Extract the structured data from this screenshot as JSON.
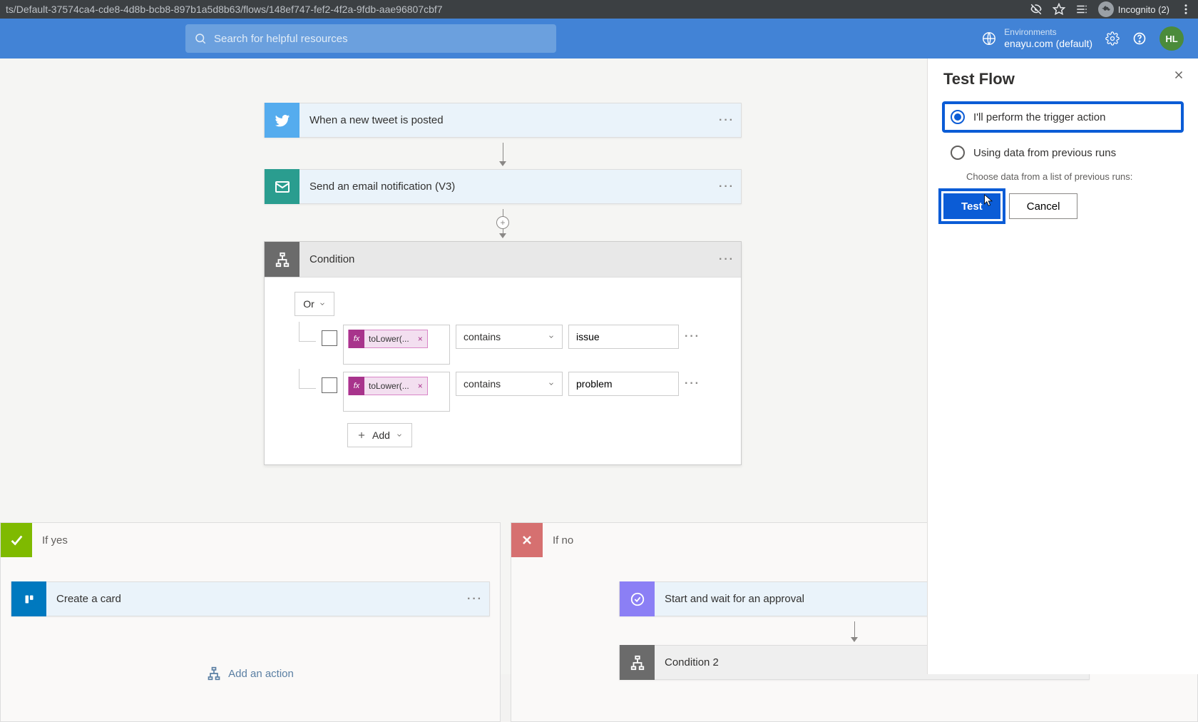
{
  "browser": {
    "url": "ts/Default-37574ca4-cde8-4d8b-bcb8-897b1a5d8b63/flows/148ef747-fef2-4f2a-9fdb-aae96807cbf7",
    "incognito": "Incognito (2)"
  },
  "header": {
    "search_placeholder": "Search for helpful resources",
    "env_label": "Environments",
    "env_name": "enayu.com (default)",
    "user_initials": "HL"
  },
  "flow": {
    "trigger": {
      "title": "When a new tweet is posted"
    },
    "step2": {
      "title": "Send an email notification (V3)"
    },
    "condition": {
      "title": "Condition",
      "group_op": "Or",
      "rows": [
        {
          "token": "toLower(...",
          "operator": "contains",
          "value": "issue"
        },
        {
          "token": "toLower(...",
          "operator": "contains",
          "value": "problem"
        }
      ],
      "add_label": "Add"
    },
    "if_yes": {
      "label": "If yes",
      "card1": "Create a card",
      "add_action": "Add an action"
    },
    "if_no": {
      "label": "If no",
      "card1": "Start and wait for an approval",
      "card2": "Condition 2"
    }
  },
  "panel": {
    "title": "Test Flow",
    "opt1": "I'll perform the trigger action",
    "opt2": "Using data from previous runs",
    "opt2_sub": "Choose data from a list of previous runs:",
    "test_btn": "Test",
    "cancel_btn": "Cancel"
  }
}
